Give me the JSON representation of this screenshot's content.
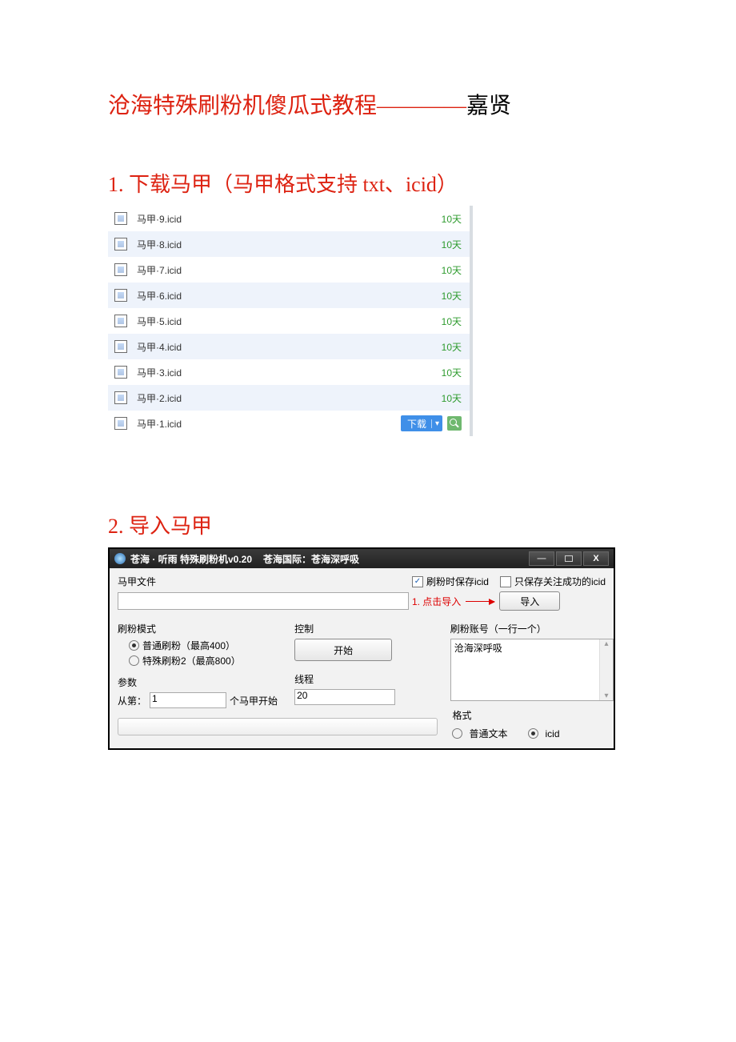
{
  "doc": {
    "title_red": "沧海特殊刷粉机傻瓜式教程————",
    "title_black": "嘉贤",
    "section1": "1. 下载马甲（马甲格式支持 txt、icid）",
    "section2": "2. 导入马甲"
  },
  "files": [
    {
      "name": "马甲·9.icid",
      "age": "10天",
      "alt": false
    },
    {
      "name": "马甲·8.icid",
      "age": "10天",
      "alt": true
    },
    {
      "name": "马甲·7.icid",
      "age": "10天",
      "alt": false
    },
    {
      "name": "马甲·6.icid",
      "age": "10天",
      "alt": true
    },
    {
      "name": "马甲·5.icid",
      "age": "10天",
      "alt": false
    },
    {
      "name": "马甲·4.icid",
      "age": "10天",
      "alt": true
    },
    {
      "name": "马甲·3.icid",
      "age": "10天",
      "alt": false
    },
    {
      "name": "马甲·2.icid",
      "age": "10天",
      "alt": true
    },
    {
      "name": "马甲·1.icid",
      "age": "",
      "alt": false,
      "download": true
    }
  ],
  "download_label": "下载",
  "app": {
    "title_left": "苍海 · 听雨    特殊刷粉机v0.20",
    "title_right": "苍海国际：苍海深呼吸",
    "file_label": "马甲文件",
    "ck_save": "刷粉时保存icid",
    "ck_only": "只保存关注成功的icid",
    "import_ann": "1. 点击导入",
    "import_btn": "导入",
    "mode_label": "刷粉模式",
    "mode_opt1": "普通刷粉（最高400）",
    "mode_opt2": "特殊刷粉2（最高800）",
    "param_label": "参数",
    "param_prefix": "从第：",
    "param_value": "1",
    "param_suffix": "个马甲开始",
    "ctrl_label": "控制",
    "start_btn": "开始",
    "thread_label": "线程",
    "thread_value": "20",
    "acc_label": "刷粉账号（一行一个）",
    "acc_value": "沧海深呼吸",
    "fmt_label": "格式",
    "fmt_opt1": "普通文本",
    "fmt_opt2": "icid"
  }
}
